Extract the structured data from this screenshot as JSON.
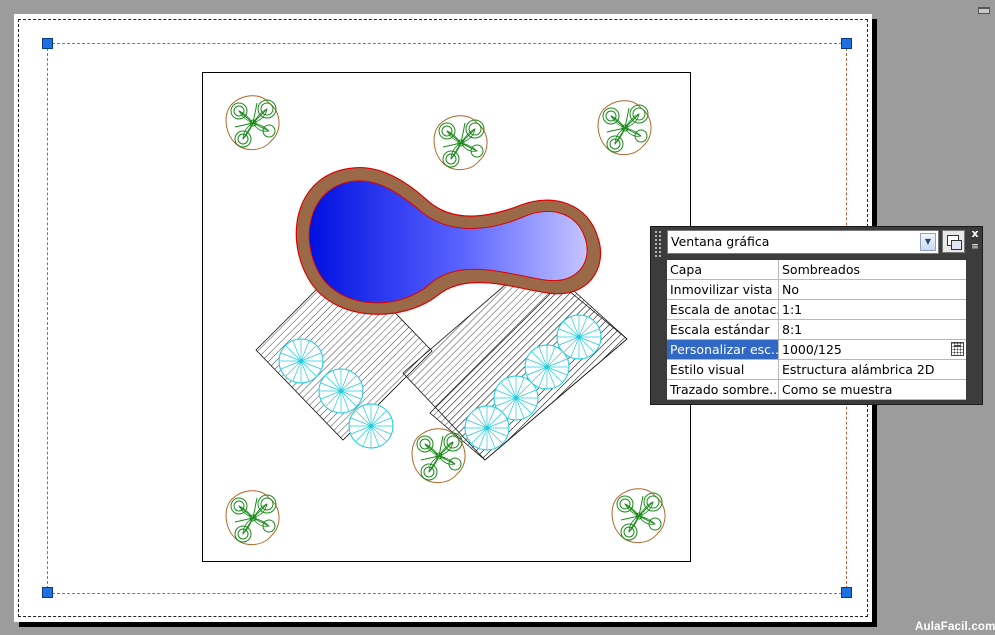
{
  "palette": {
    "object_type": "Ventana gráfica",
    "close_glyph": "x",
    "menu_glyph": "≡",
    "properties": [
      {
        "label": "Capa",
        "value": "Sombreados"
      },
      {
        "label": "Inmovilizar vista",
        "value": "No"
      },
      {
        "label": "Escala de anotac...",
        "value": "1:1"
      },
      {
        "label": "Escala estándar",
        "value": "8:1"
      },
      {
        "label": "Personalizar esc...",
        "value": "1000/125"
      },
      {
        "label": "Estilo visual",
        "value": "Estructura alámbrica 2D"
      },
      {
        "label": "Trazado sombre...",
        "value": "Como se muestra"
      }
    ],
    "selected_property": "Personalizar esc...",
    "selected_color": "#3168c6"
  },
  "watermark": "AulaFacil.com",
  "colors": {
    "background": "#9c9c9c",
    "pool_deep": "#0010e0",
    "pool_light": "#c4c4ff",
    "pool_rim": "#9a6a48",
    "pool_edge": "#e00000",
    "plant_green": "#1a8a1a",
    "plant_brown": "#b0662a",
    "stepping_stone": "#22ccdd",
    "grip_blue": "#1e6fe0"
  },
  "icons": [
    "quick-select-icon",
    "close-icon",
    "palette-menu-icon",
    "calculator-icon",
    "dropdown-arrow-icon",
    "minimize-icon"
  ]
}
